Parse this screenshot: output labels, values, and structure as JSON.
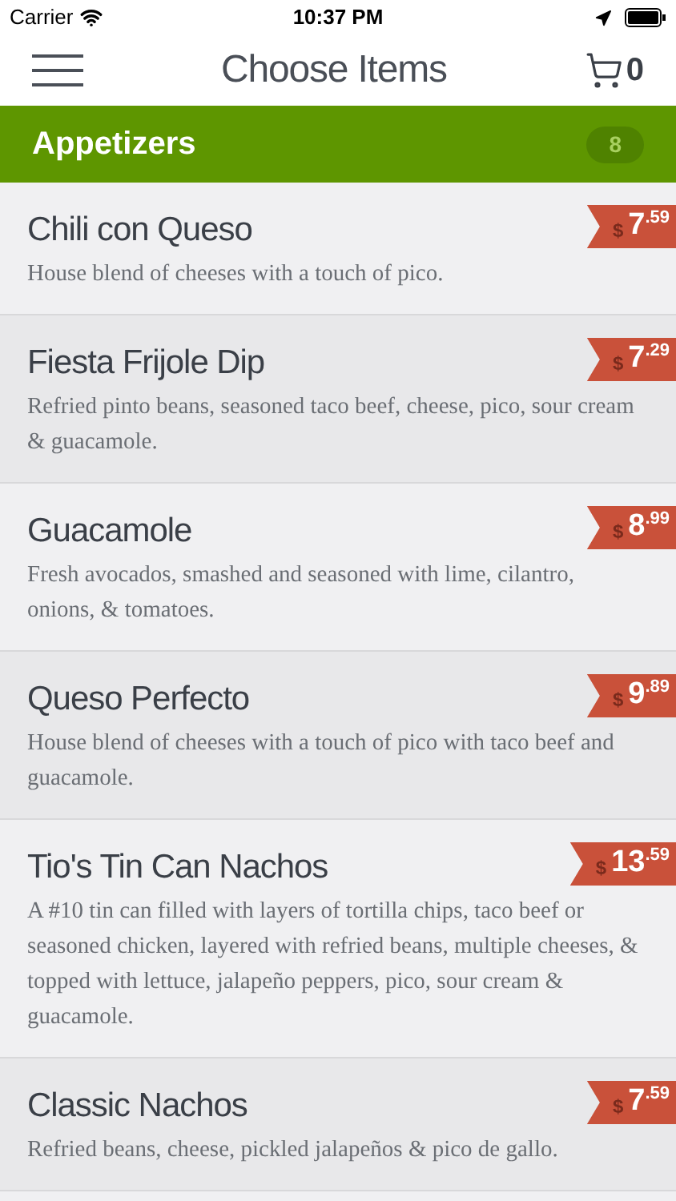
{
  "status_bar": {
    "carrier": "Carrier",
    "time": "10:37 PM"
  },
  "nav": {
    "title": "Choose Items",
    "cart_count": "0"
  },
  "section": {
    "title": "Appetizers",
    "count": "8"
  },
  "items": [
    {
      "name": "Chili con Queso",
      "description": "House blend of cheeses with a touch of pico.",
      "currency": "$",
      "whole": "7",
      "cents": ".59"
    },
    {
      "name": "Fiesta Frijole Dip",
      "description": "Refried pinto beans, seasoned taco beef, cheese, pico, sour cream & guacamole.",
      "currency": "$",
      "whole": "7",
      "cents": ".29"
    },
    {
      "name": "Guacamole",
      "description": "Fresh avocados, smashed and seasoned with lime, cilantro, onions, & tomatoes.",
      "currency": "$",
      "whole": "8",
      "cents": ".99"
    },
    {
      "name": "Queso Perfecto",
      "description": "House blend of cheeses with a touch of pico with taco beef and guacamole.",
      "currency": "$",
      "whole": "9",
      "cents": ".89"
    },
    {
      "name": "Tio's Tin Can Nachos",
      "description": "A #10 tin can filled with layers of tortilla chips, taco beef or seasoned chicken, layered with refried beans, multiple cheeses, & topped with lettuce, jalapeño peppers, pico, sour cream & guacamole.",
      "currency": "$",
      "whole": "13",
      "cents": ".59"
    },
    {
      "name": "Classic Nachos",
      "description": "Refried beans, cheese, pickled jalapeños & pico de gallo.",
      "currency": "$",
      "whole": "7",
      "cents": ".59"
    }
  ]
}
